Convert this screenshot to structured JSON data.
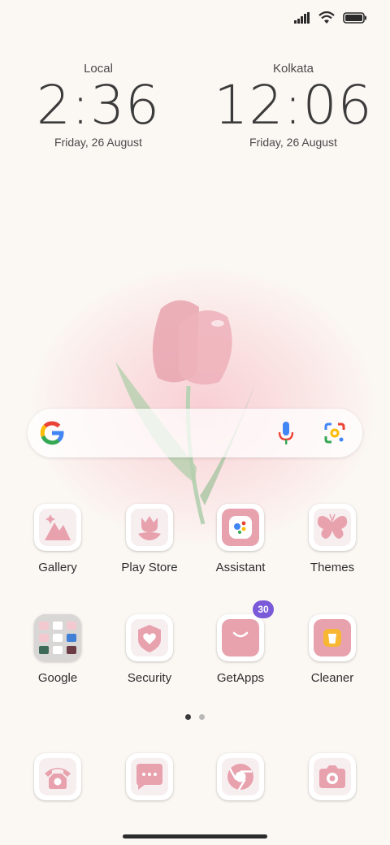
{
  "status_bar": {
    "signal": "signal-icon",
    "wifi": "wifi-icon",
    "battery": "battery-icon"
  },
  "clocks": [
    {
      "city": "Local",
      "time": "2:36",
      "date": "Friday, 26 August"
    },
    {
      "city": "Kolkata",
      "time": "12:06",
      "date": "Friday, 26 August"
    }
  ],
  "search": {
    "logo": "google-logo-icon",
    "mic": "mic-icon",
    "lens": "lens-icon"
  },
  "apps_row1": [
    {
      "label": "Gallery",
      "icon": "gallery-icon"
    },
    {
      "label": "Play Store",
      "icon": "tulip-icon"
    },
    {
      "label": "Assistant",
      "icon": "assistant-icon"
    },
    {
      "label": "Themes",
      "icon": "butterfly-icon"
    }
  ],
  "apps_row2": [
    {
      "label": "Google",
      "icon": "folder-icon"
    },
    {
      "label": "Security",
      "icon": "shield-heart-icon"
    },
    {
      "label": "GetApps",
      "icon": "shopping-bag-icon",
      "badge": "30"
    },
    {
      "label": "Cleaner",
      "icon": "trash-icon"
    }
  ],
  "dock": [
    {
      "icon": "phone-icon"
    },
    {
      "icon": "messages-icon"
    },
    {
      "icon": "browser-icon"
    },
    {
      "icon": "camera-icon"
    }
  ],
  "page_indicator": {
    "pages": 2,
    "current": 1
  },
  "colors": {
    "background": "#fbf7f3",
    "icon_pink": "#e8a2ae",
    "badge": "#7a5ad8",
    "text": "#2f2f2f"
  }
}
